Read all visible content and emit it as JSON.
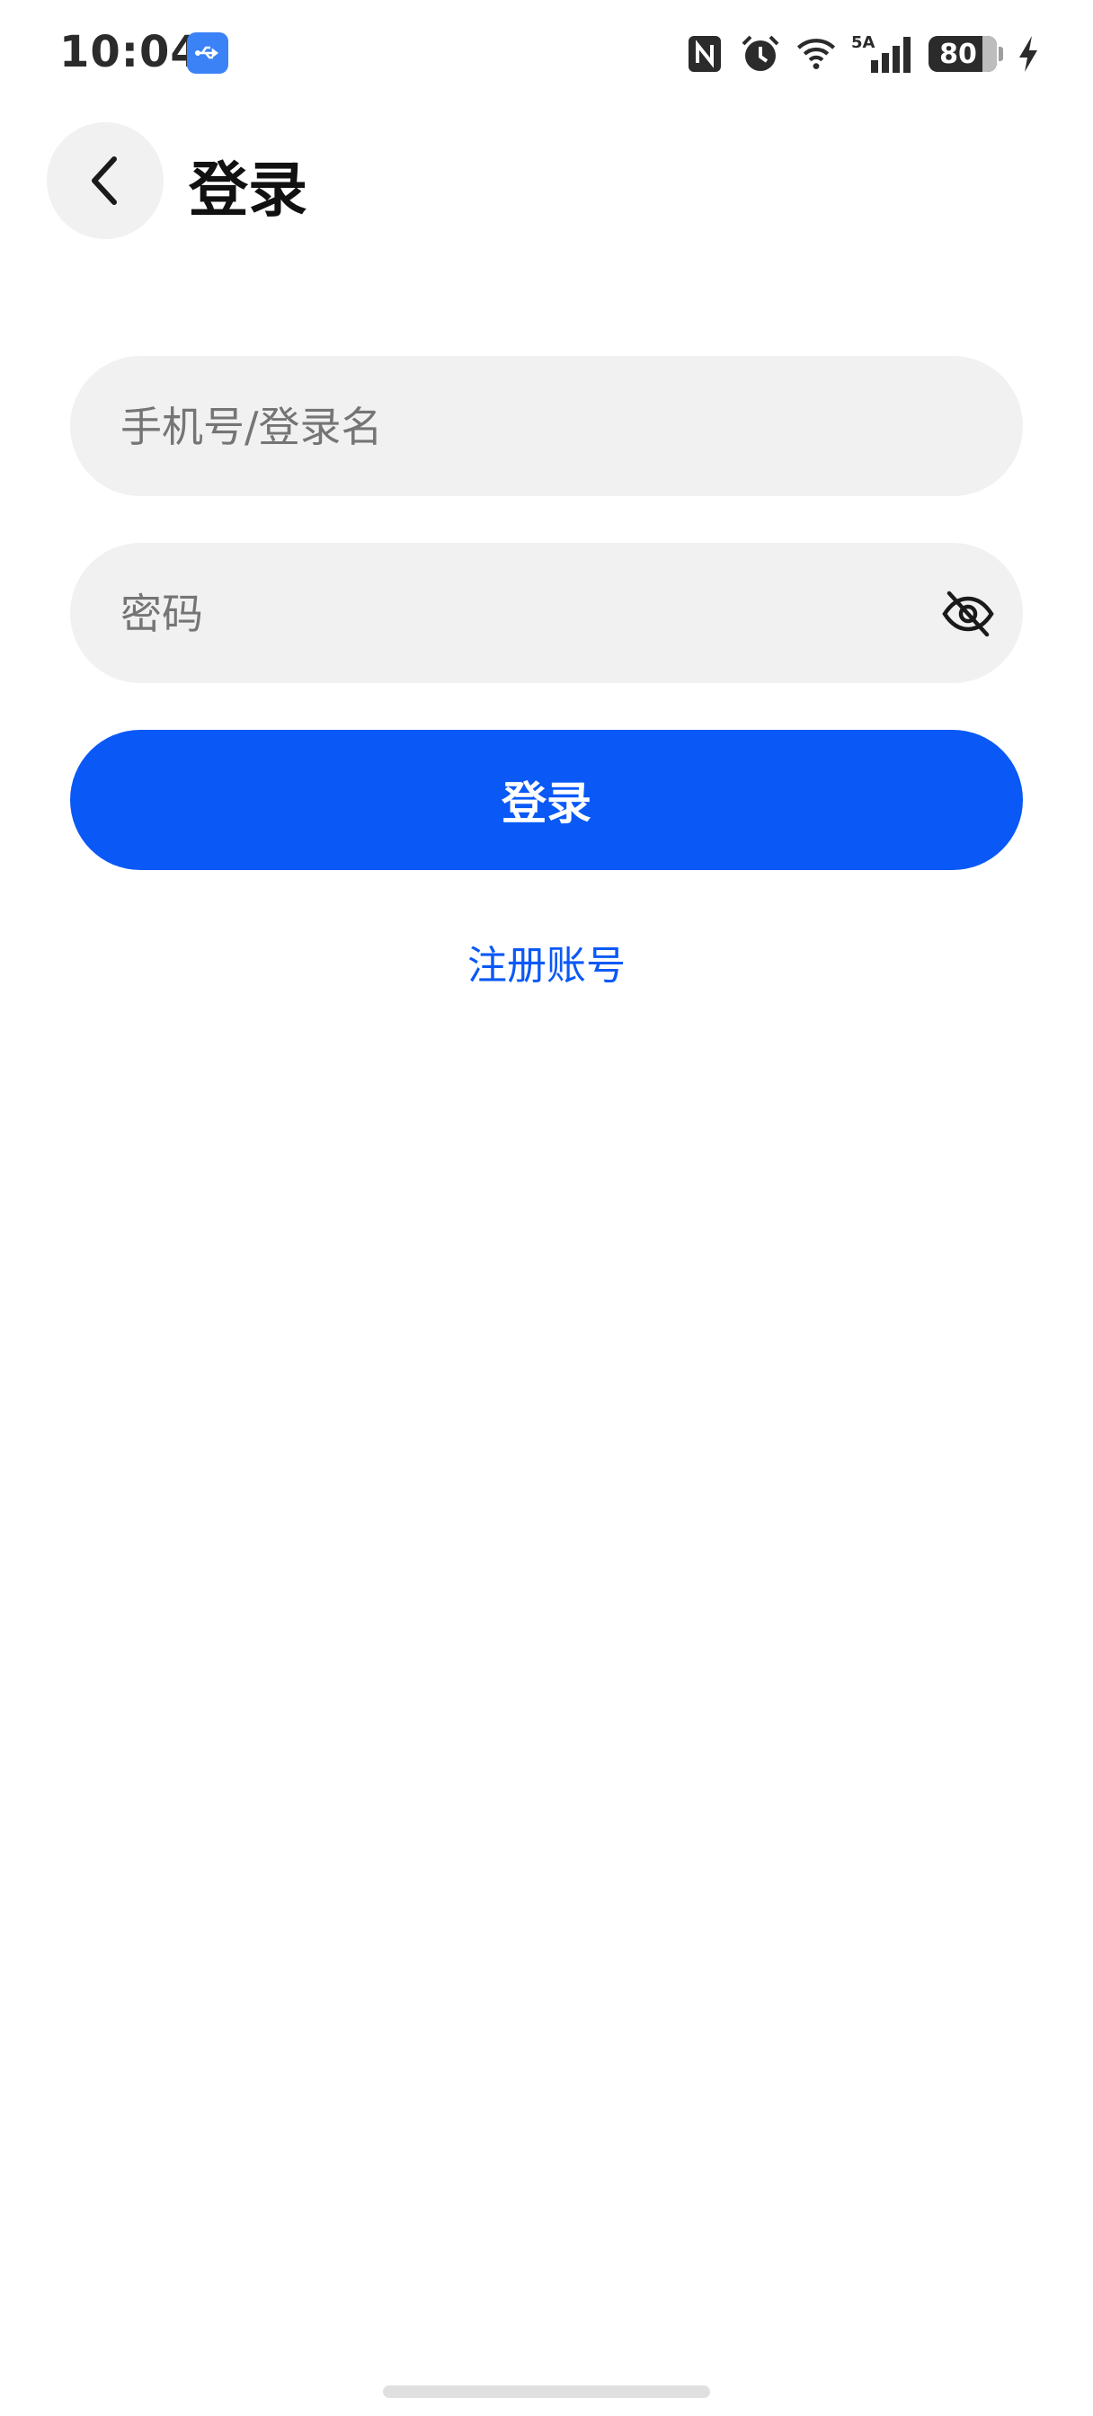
{
  "status_bar": {
    "time": "10:04",
    "icons": [
      "usb-icon",
      "nfc-icon",
      "alarm-icon",
      "wifi-icon",
      "signal-5a-icon",
      "battery-icon",
      "charging-icon"
    ],
    "network_label": "5A",
    "battery_level": "80"
  },
  "header": {
    "back_icon": "chevron-left-icon",
    "title": "登录"
  },
  "form": {
    "phone_placeholder": "手机号/登录名",
    "phone_value": "",
    "password_placeholder": "密码",
    "password_value": "",
    "password_visibility_icon": "eye-off-icon",
    "login_label": "登录",
    "register_label": "注册账号"
  },
  "colors": {
    "accent": "#0a59f7",
    "field_background": "#f1f1f1",
    "usb_badge": "#3b82f6"
  }
}
